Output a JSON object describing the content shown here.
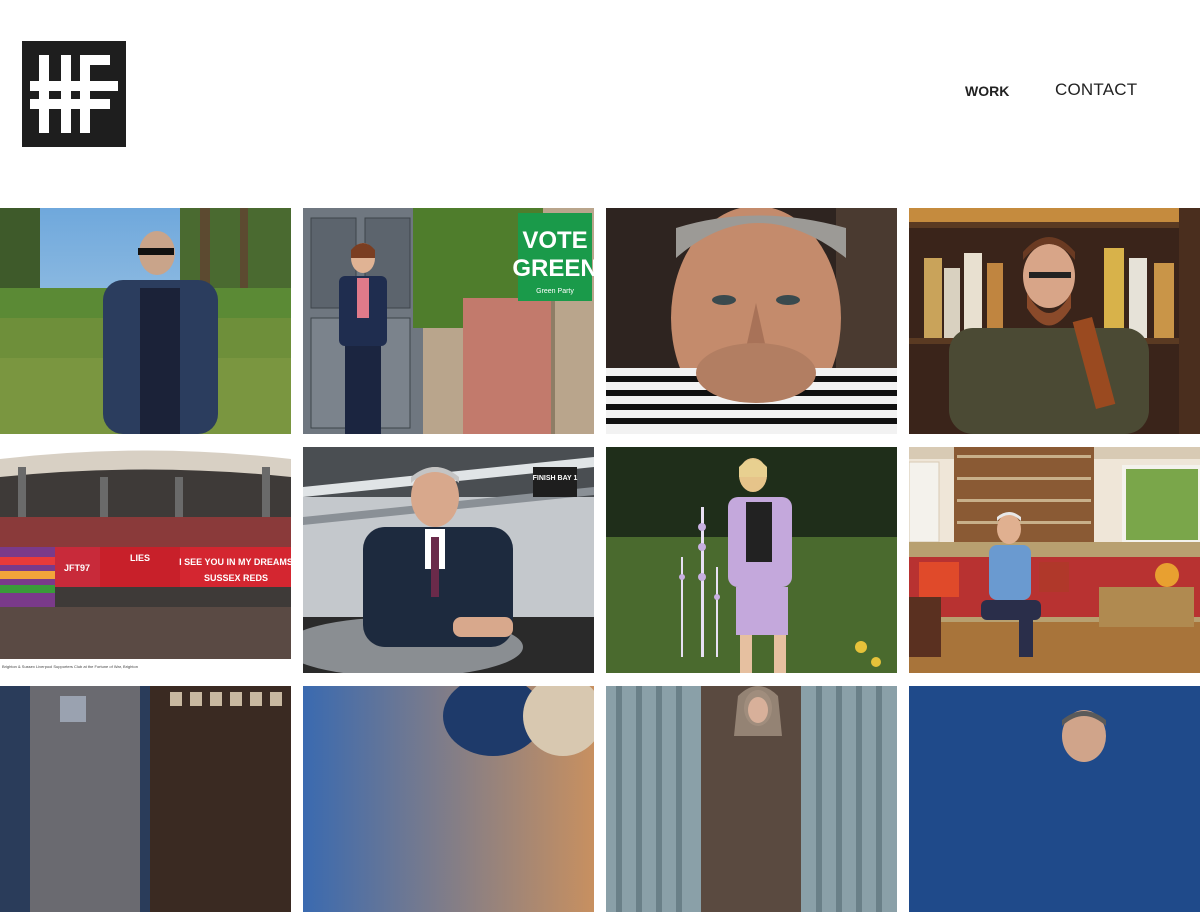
{
  "header": {
    "logo_alt": "HF logo",
    "nav": {
      "work": "WORK",
      "contact": "CONTACT"
    }
  },
  "gallery": {
    "tiles": [
      {
        "row": 0,
        "col": 0,
        "subject": "man in denim jacket in field"
      },
      {
        "row": 0,
        "col": 1,
        "subject": "woman by door with sign",
        "sign_text_1": "VOTE",
        "sign_text_2": "GREEN",
        "sign_small": "Green Party"
      },
      {
        "row": 0,
        "col": 2,
        "subject": "close-up portrait of older man"
      },
      {
        "row": 0,
        "col": 3,
        "subject": "bearded man with whisky bottle"
      },
      {
        "row": 1,
        "col": 0,
        "subject": "football fans with banners",
        "banner_1": "I SEE YOU IN MY DREAMS",
        "banner_2": "SUSSEX REDS",
        "banner_3": "JFT97",
        "banner_4": "LIES",
        "caption": "Brighton & Sussex Liverpool Supporters Club at the Fortune of War, Brighton"
      },
      {
        "row": 1,
        "col": 1,
        "subject": "man in suit leaning on car",
        "sign": "FINISH BAY 1"
      },
      {
        "row": 1,
        "col": 2,
        "subject": "woman in lilac suit in garden"
      },
      {
        "row": 1,
        "col": 3,
        "subject": "man seated in library room"
      },
      {
        "row": 2,
        "col": 0,
        "subject": "building at dusk"
      },
      {
        "row": 2,
        "col": 1,
        "subject": "sky and barrels"
      },
      {
        "row": 2,
        "col": 2,
        "subject": "man with long hair and curtains"
      },
      {
        "row": 2,
        "col": 3,
        "subject": "man against blue background"
      }
    ]
  },
  "colors": {
    "logo_bg": "#1e1e1e",
    "logo_fg": "#ffffff",
    "nav_text": "#222222",
    "page_bg": "#ffffff"
  }
}
